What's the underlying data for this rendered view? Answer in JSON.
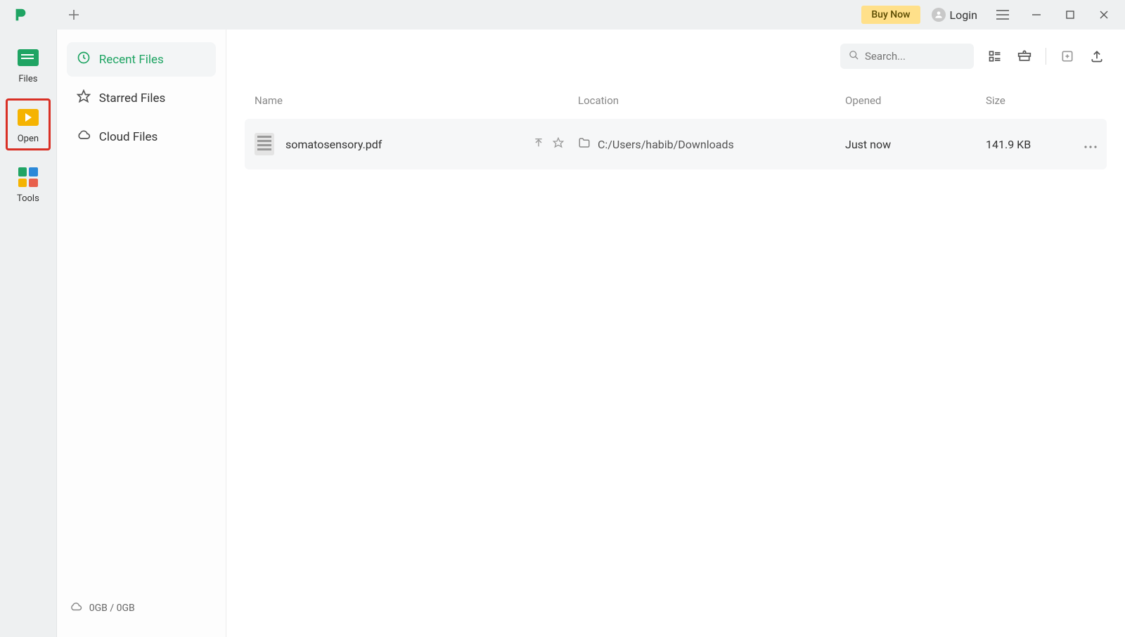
{
  "titlebar": {
    "buy_now": "Buy Now",
    "login": "Login"
  },
  "nav": {
    "files": "Files",
    "open": "Open",
    "tools": "Tools"
  },
  "sidebar": {
    "recent": "Recent Files",
    "starred": "Starred Files",
    "cloud": "Cloud Files",
    "storage": "0GB / 0GB"
  },
  "toolbar": {
    "search_placeholder": "Search..."
  },
  "table": {
    "headers": {
      "name": "Name",
      "location": "Location",
      "opened": "Opened",
      "size": "Size"
    },
    "rows": [
      {
        "name": "somatosensory.pdf",
        "location": "C:/Users/habib/Downloads",
        "opened": "Just now",
        "size": "141.9 KB"
      }
    ]
  }
}
